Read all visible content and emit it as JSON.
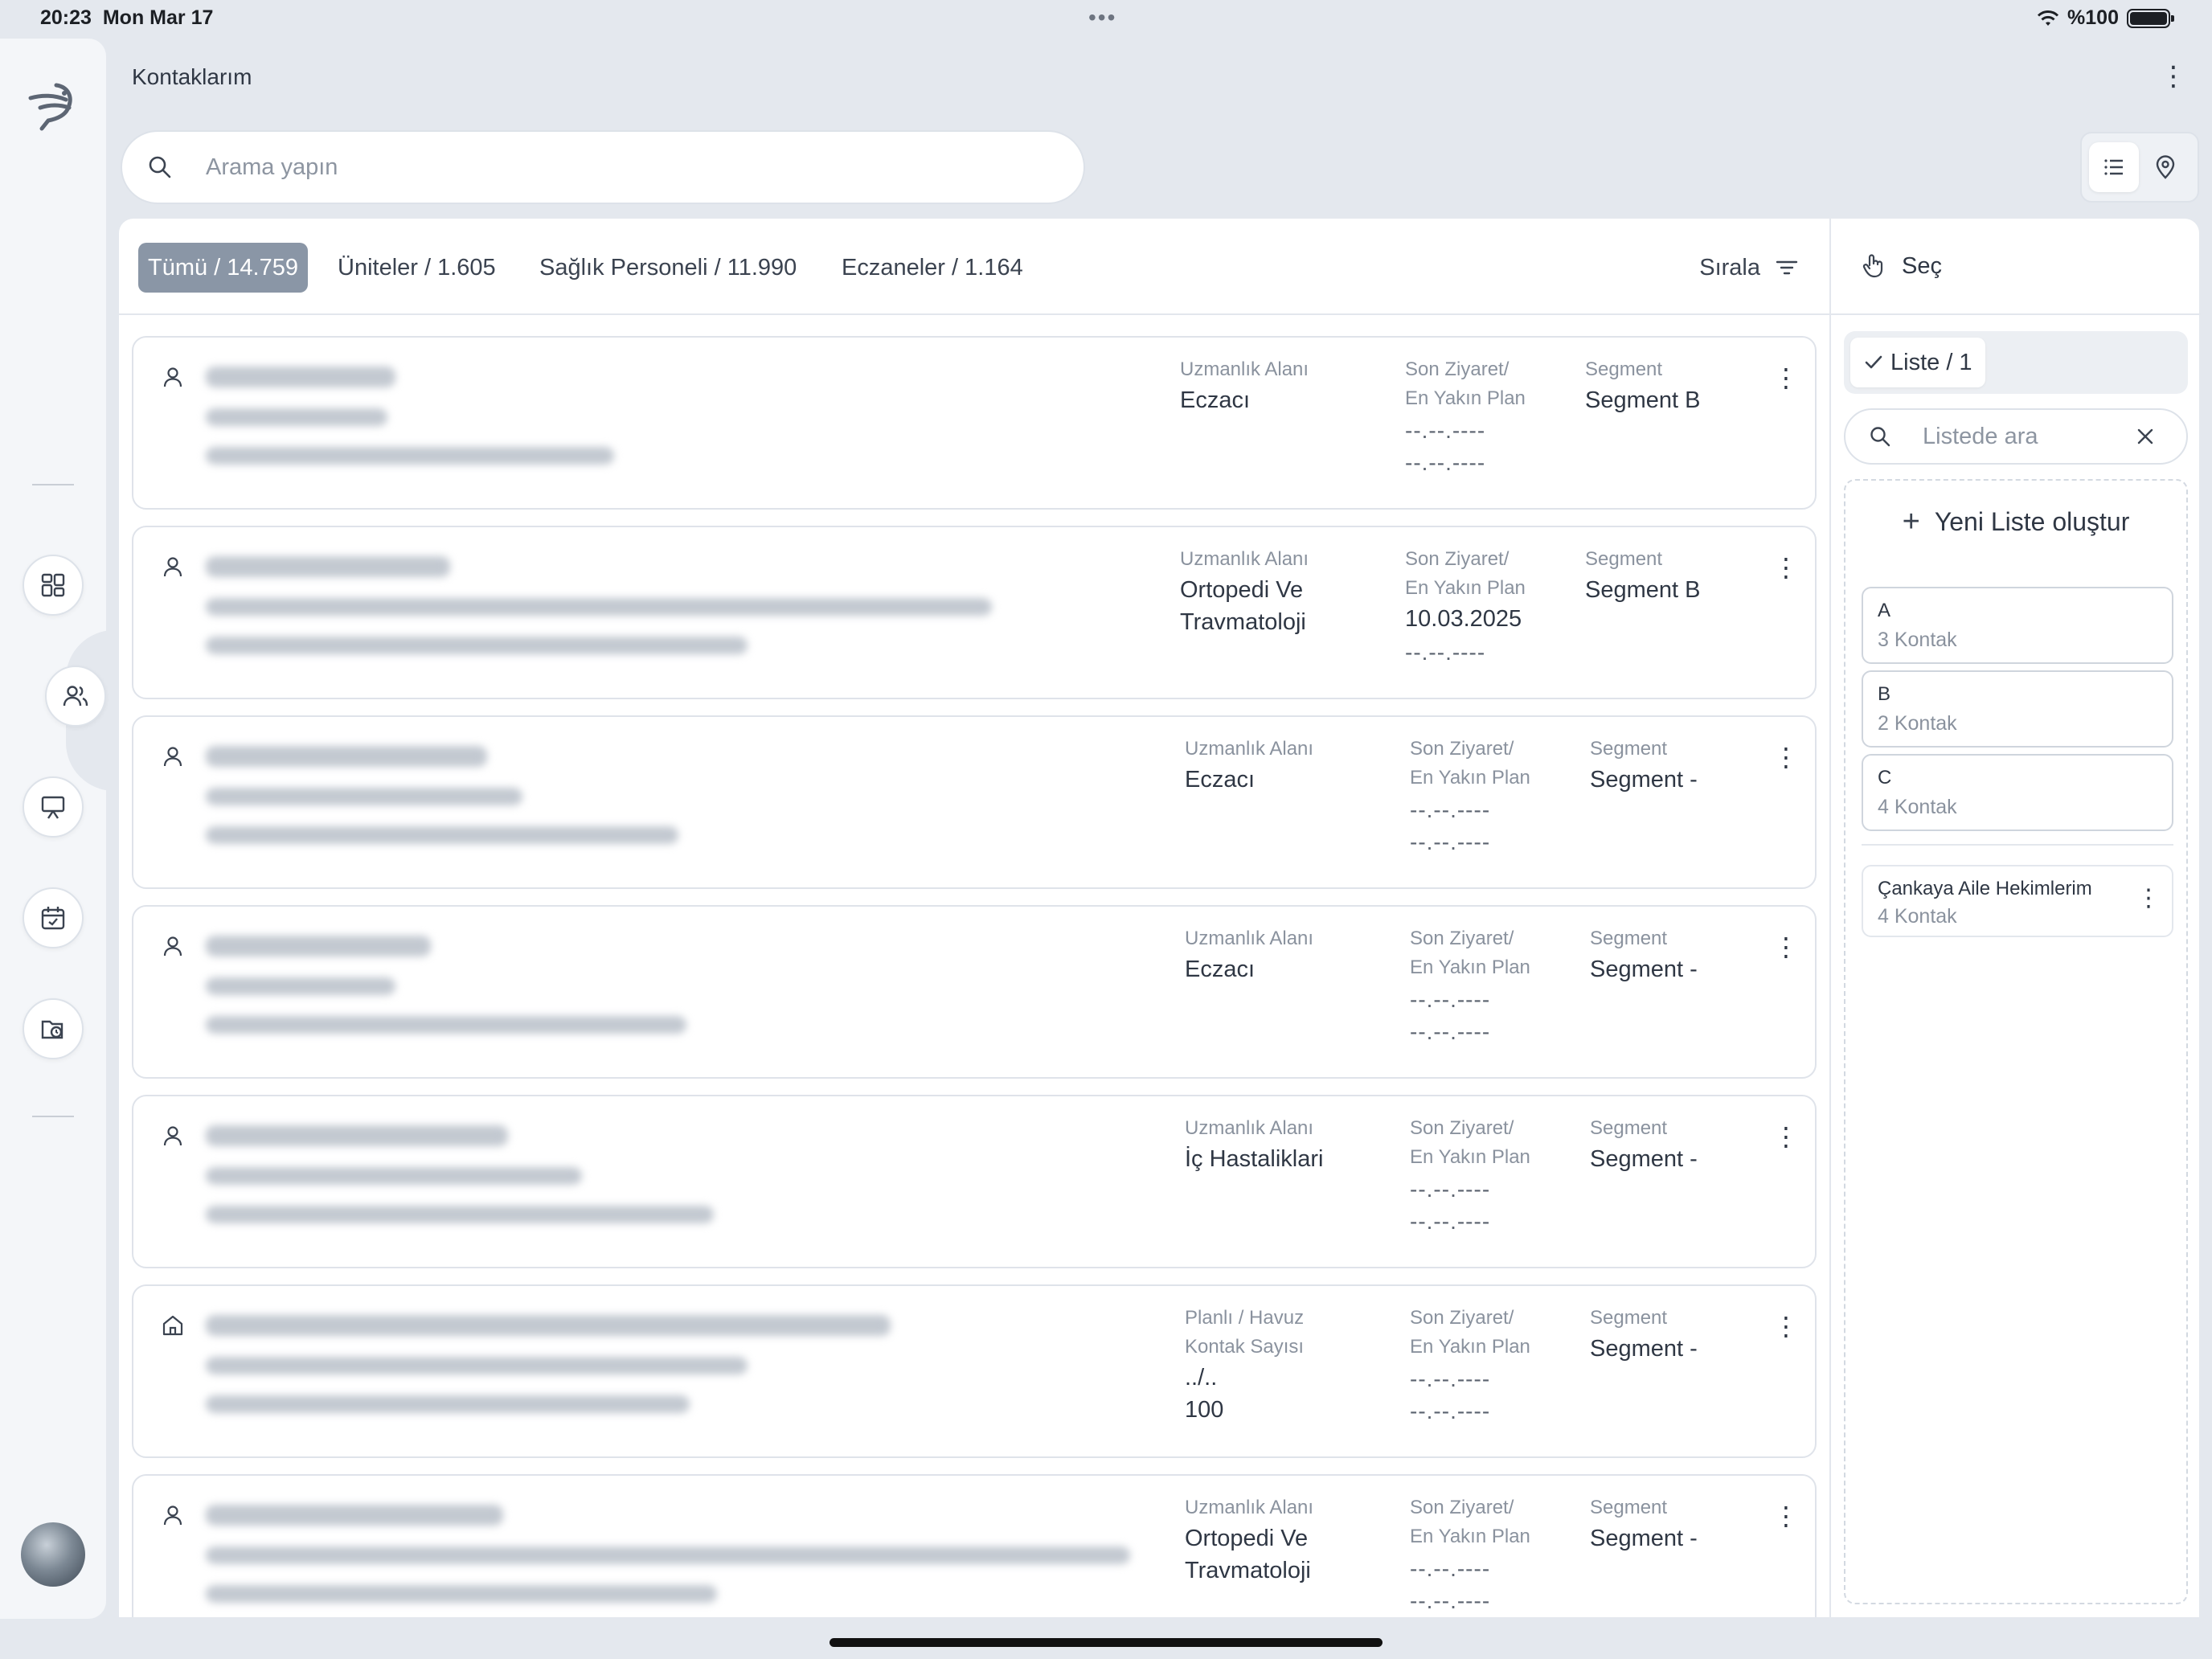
{
  "status_bar": {
    "time": "20:23",
    "date": "Mon Mar 17",
    "battery": "%100"
  },
  "header": {
    "title": "Kontaklarım"
  },
  "search": {
    "placeholder": "Arama yapın"
  },
  "filters": {
    "chips": [
      {
        "label": "Tümü / 14.759",
        "active": true
      },
      {
        "label": "Üniteler / 1.605",
        "active": false
      },
      {
        "label": "Sağlık Personeli / 11.990",
        "active": false
      },
      {
        "label": "Eczaneler / 1.164",
        "active": false
      }
    ],
    "sort_label": "Sırala"
  },
  "contacts": [
    {
      "type": "person",
      "col1_label": "Uzmanlık Alanı",
      "col1_lines": [
        "Eczacı"
      ],
      "visit_label_1": "Son Ziyaret/",
      "visit_label_2": "En Yakın Plan",
      "last_visit": "--.--.----",
      "next_plan": "--.--.----",
      "segment_label": "Segment",
      "segment": "Segment B"
    },
    {
      "type": "person",
      "col1_label": "Uzmanlık Alanı",
      "col1_lines": [
        "Ortopedi Ve",
        "Travmatoloji"
      ],
      "visit_label_1": "Son Ziyaret/",
      "visit_label_2": "En Yakın Plan",
      "last_visit": "10.03.2025",
      "next_plan": "--.--.----",
      "segment_label": "Segment",
      "segment": "Segment B"
    },
    {
      "type": "person",
      "col1_label": "Uzmanlık Alanı",
      "col1_lines": [
        "Eczacı"
      ],
      "visit_label_1": "Son Ziyaret/",
      "visit_label_2": "En Yakın Plan",
      "last_visit": "--.--.----",
      "next_plan": "--.--.----",
      "segment_label": "Segment",
      "segment": "Segment -"
    },
    {
      "type": "person",
      "col1_label": "Uzmanlık Alanı",
      "col1_lines": [
        "Eczacı"
      ],
      "visit_label_1": "Son Ziyaret/",
      "visit_label_2": "En Yakın Plan",
      "last_visit": "--.--.----",
      "next_plan": "--.--.----",
      "segment_label": "Segment",
      "segment": "Segment -"
    },
    {
      "type": "person",
      "col1_label": "Uzmanlık Alanı",
      "col1_lines": [
        "İç Hastaliklari"
      ],
      "visit_label_1": "Son Ziyaret/",
      "visit_label_2": "En Yakın Plan",
      "last_visit": "--.--.----",
      "next_plan": "--.--.----",
      "segment_label": "Segment",
      "segment": "Segment -"
    },
    {
      "type": "unit",
      "col1_label": "Planlı / Havuz",
      "col1_label2": "Kontak Sayısı",
      "col1_lines": [
        "../..",
        "100"
      ],
      "visit_label_1": "Son Ziyaret/",
      "visit_label_2": "En Yakın Plan",
      "last_visit": "--.--.----",
      "next_plan": "--.--.----",
      "segment_label": "Segment",
      "segment": "Segment -"
    },
    {
      "type": "person",
      "col1_label": "Uzmanlık Alanı",
      "col1_lines": [
        "Ortopedi Ve",
        "Travmatoloji"
      ],
      "visit_label_1": "Son Ziyaret/",
      "visit_label_2": "En Yakın Plan",
      "last_visit": "--.--.----",
      "next_plan": "--.--.----",
      "segment_label": "Segment",
      "segment": "Segment -"
    }
  ],
  "right_panel": {
    "select_label": "Seç",
    "tab_label": "Liste / 1",
    "search_placeholder": "Listede ara",
    "new_list_label": "Yeni Liste oluştur",
    "lists": [
      {
        "name": "A",
        "count": "3 Kontak"
      },
      {
        "name": "B",
        "count": "2 Kontak"
      },
      {
        "name": "C",
        "count": "4 Kontak"
      }
    ],
    "saved_lists": [
      {
        "name": "Çankaya Aile Hekimlerim",
        "count": "4 Kontak"
      }
    ]
  }
}
